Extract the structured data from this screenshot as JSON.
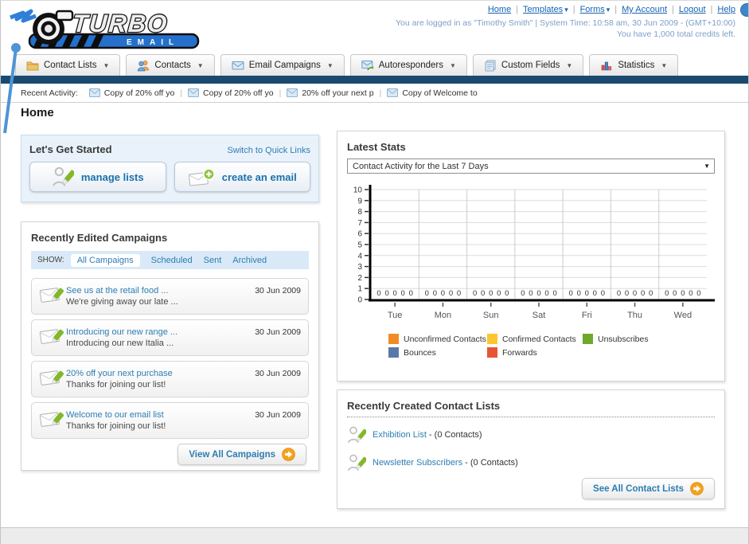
{
  "header": {
    "logo": {
      "title": "TURBO",
      "subtitle": "EMAIL"
    },
    "nav_links": [
      {
        "label": "Home"
      },
      {
        "label": "Templates"
      },
      {
        "label": "Forms"
      },
      {
        "label": "My Account"
      },
      {
        "label": "Logout"
      },
      {
        "label": "Help"
      }
    ],
    "login_line1": "You are logged in as \"Timothy Smith\" | System Time: 10:58 am, 30 Jun 2009 - (GMT+10:00)",
    "login_line2": "You have 1,000 total credits left."
  },
  "tabs": [
    {
      "label": "Contact Lists",
      "icon": "folder-icon"
    },
    {
      "label": "Contacts",
      "icon": "contacts-icon"
    },
    {
      "label": "Email Campaigns",
      "icon": "envelope-icon"
    },
    {
      "label": "Autoresponders",
      "icon": "autoresponder-icon"
    },
    {
      "label": "Custom Fields",
      "icon": "custom-fields-icon"
    },
    {
      "label": "Statistics",
      "icon": "statistics-icon"
    }
  ],
  "recent_activity": {
    "label": "Recent Activity:",
    "items": [
      "Copy of 20% off yo",
      "Copy of 20% off yo",
      "20% off your next p",
      "Copy of Welcome to"
    ]
  },
  "page_title": "Home",
  "get_started": {
    "title": "Let's Get Started",
    "switch_link": "Switch to Quick Links",
    "buttons": [
      {
        "label": "manage lists",
        "icon": "person-pencil-icon"
      },
      {
        "label": "create an email",
        "icon": "envelope-plus-icon"
      }
    ]
  },
  "campaigns_panel": {
    "title": "Recently Edited Campaigns",
    "show_label": "SHOW:",
    "filters": [
      "All Campaigns",
      "Scheduled",
      "Sent",
      "Archived"
    ],
    "active_filter": "All Campaigns",
    "items": [
      {
        "title": "See us at the retail food ...",
        "subtitle": "We're giving away our late ...",
        "date": "30 Jun 2009"
      },
      {
        "title": "Introducing our new range ...",
        "subtitle": "Introducing our new Italia ...",
        "date": "30 Jun 2009"
      },
      {
        "title": "20% off your next purchase",
        "subtitle": "Thanks for joining our list!",
        "date": "30 Jun 2009"
      },
      {
        "title": "Welcome to our email list",
        "subtitle": "Thanks for joining our list!",
        "date": "30 Jun 2009"
      }
    ],
    "view_all_label": "View All Campaigns"
  },
  "stats_panel": {
    "title": "Latest Stats",
    "dropdown_value": "Contact Activity for the Last 7 Days"
  },
  "chart_data": {
    "type": "bar",
    "title": "Contact Activity for the Last 7 Days",
    "categories": [
      "Tue",
      "Mon",
      "Sun",
      "Sat",
      "Fri",
      "Thu",
      "Wed"
    ],
    "series": [
      {
        "name": "Unconfirmed Contacts",
        "color": "#f08c28",
        "values": [
          0,
          0,
          0,
          0,
          0,
          0,
          0
        ]
      },
      {
        "name": "Confirmed Contacts",
        "color": "#fdc62e",
        "values": [
          0,
          0,
          0,
          0,
          0,
          0,
          0
        ]
      },
      {
        "name": "Unsubscribes",
        "color": "#6fa82a",
        "values": [
          0,
          0,
          0,
          0,
          0,
          0,
          0
        ]
      },
      {
        "name": "Bounces",
        "color": "#5b78ab",
        "values": [
          0,
          0,
          0,
          0,
          0,
          0,
          0
        ]
      },
      {
        "name": "Forwards",
        "color": "#e85436",
        "values": [
          0,
          0,
          0,
          0,
          0,
          0,
          0
        ]
      }
    ],
    "xlabel": "",
    "ylabel": "",
    "ylim": [
      0,
      10
    ],
    "ytick_step": 1,
    "grid": true,
    "legend_position": "bottom",
    "value_labels_shown": true
  },
  "contact_lists_panel": {
    "title": "Recently Created Contact Lists",
    "items": [
      {
        "name": "Exhibition List",
        "suffix": " - (0 Contacts)"
      },
      {
        "name": "Newsletter Subscribers",
        "suffix": " - (0 Contacts)"
      }
    ],
    "see_all_label": "See All Contact Lists"
  },
  "colors": {
    "navy_bar": "#1b4a70",
    "link_blue": "#2d7db3",
    "header_link_blue": "#1464b4",
    "arrow_button_orange": "#f6a21d",
    "logo_blue": "#2f7fd9"
  }
}
